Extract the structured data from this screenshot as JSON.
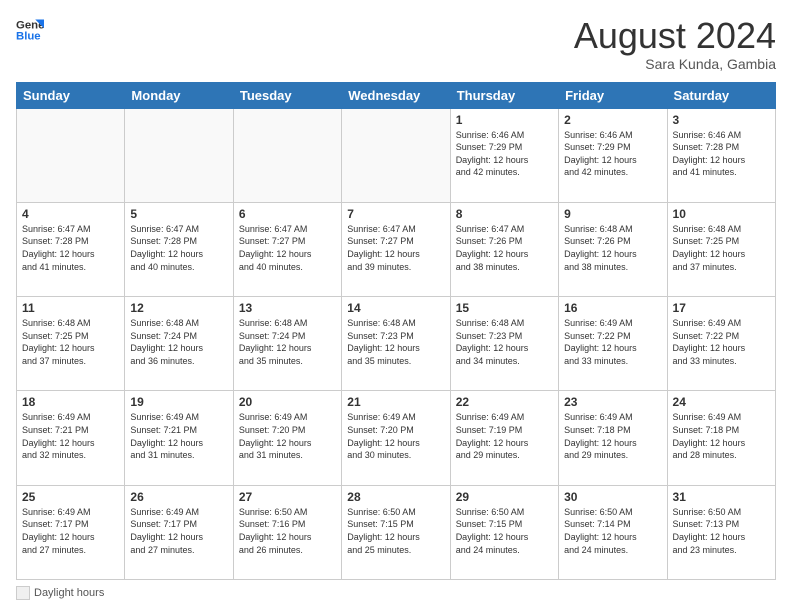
{
  "logo": {
    "line1": "General",
    "line2": "Blue",
    "tagline": ""
  },
  "header": {
    "month": "August 2024",
    "location": "Sara Kunda, Gambia"
  },
  "weekdays": [
    "Sunday",
    "Monday",
    "Tuesday",
    "Wednesday",
    "Thursday",
    "Friday",
    "Saturday"
  ],
  "weeks": [
    [
      {
        "day": "",
        "info": ""
      },
      {
        "day": "",
        "info": ""
      },
      {
        "day": "",
        "info": ""
      },
      {
        "day": "",
        "info": ""
      },
      {
        "day": "1",
        "info": "Sunrise: 6:46 AM\nSunset: 7:29 PM\nDaylight: 12 hours\nand 42 minutes."
      },
      {
        "day": "2",
        "info": "Sunrise: 6:46 AM\nSunset: 7:29 PM\nDaylight: 12 hours\nand 42 minutes."
      },
      {
        "day": "3",
        "info": "Sunrise: 6:46 AM\nSunset: 7:28 PM\nDaylight: 12 hours\nand 41 minutes."
      }
    ],
    [
      {
        "day": "4",
        "info": "Sunrise: 6:47 AM\nSunset: 7:28 PM\nDaylight: 12 hours\nand 41 minutes."
      },
      {
        "day": "5",
        "info": "Sunrise: 6:47 AM\nSunset: 7:28 PM\nDaylight: 12 hours\nand 40 minutes."
      },
      {
        "day": "6",
        "info": "Sunrise: 6:47 AM\nSunset: 7:27 PM\nDaylight: 12 hours\nand 40 minutes."
      },
      {
        "day": "7",
        "info": "Sunrise: 6:47 AM\nSunset: 7:27 PM\nDaylight: 12 hours\nand 39 minutes."
      },
      {
        "day": "8",
        "info": "Sunrise: 6:47 AM\nSunset: 7:26 PM\nDaylight: 12 hours\nand 38 minutes."
      },
      {
        "day": "9",
        "info": "Sunrise: 6:48 AM\nSunset: 7:26 PM\nDaylight: 12 hours\nand 38 minutes."
      },
      {
        "day": "10",
        "info": "Sunrise: 6:48 AM\nSunset: 7:25 PM\nDaylight: 12 hours\nand 37 minutes."
      }
    ],
    [
      {
        "day": "11",
        "info": "Sunrise: 6:48 AM\nSunset: 7:25 PM\nDaylight: 12 hours\nand 37 minutes."
      },
      {
        "day": "12",
        "info": "Sunrise: 6:48 AM\nSunset: 7:24 PM\nDaylight: 12 hours\nand 36 minutes."
      },
      {
        "day": "13",
        "info": "Sunrise: 6:48 AM\nSunset: 7:24 PM\nDaylight: 12 hours\nand 35 minutes."
      },
      {
        "day": "14",
        "info": "Sunrise: 6:48 AM\nSunset: 7:23 PM\nDaylight: 12 hours\nand 35 minutes."
      },
      {
        "day": "15",
        "info": "Sunrise: 6:48 AM\nSunset: 7:23 PM\nDaylight: 12 hours\nand 34 minutes."
      },
      {
        "day": "16",
        "info": "Sunrise: 6:49 AM\nSunset: 7:22 PM\nDaylight: 12 hours\nand 33 minutes."
      },
      {
        "day": "17",
        "info": "Sunrise: 6:49 AM\nSunset: 7:22 PM\nDaylight: 12 hours\nand 33 minutes."
      }
    ],
    [
      {
        "day": "18",
        "info": "Sunrise: 6:49 AM\nSunset: 7:21 PM\nDaylight: 12 hours\nand 32 minutes."
      },
      {
        "day": "19",
        "info": "Sunrise: 6:49 AM\nSunset: 7:21 PM\nDaylight: 12 hours\nand 31 minutes."
      },
      {
        "day": "20",
        "info": "Sunrise: 6:49 AM\nSunset: 7:20 PM\nDaylight: 12 hours\nand 31 minutes."
      },
      {
        "day": "21",
        "info": "Sunrise: 6:49 AM\nSunset: 7:20 PM\nDaylight: 12 hours\nand 30 minutes."
      },
      {
        "day": "22",
        "info": "Sunrise: 6:49 AM\nSunset: 7:19 PM\nDaylight: 12 hours\nand 29 minutes."
      },
      {
        "day": "23",
        "info": "Sunrise: 6:49 AM\nSunset: 7:18 PM\nDaylight: 12 hours\nand 29 minutes."
      },
      {
        "day": "24",
        "info": "Sunrise: 6:49 AM\nSunset: 7:18 PM\nDaylight: 12 hours\nand 28 minutes."
      }
    ],
    [
      {
        "day": "25",
        "info": "Sunrise: 6:49 AM\nSunset: 7:17 PM\nDaylight: 12 hours\nand 27 minutes."
      },
      {
        "day": "26",
        "info": "Sunrise: 6:49 AM\nSunset: 7:17 PM\nDaylight: 12 hours\nand 27 minutes."
      },
      {
        "day": "27",
        "info": "Sunrise: 6:50 AM\nSunset: 7:16 PM\nDaylight: 12 hours\nand 26 minutes."
      },
      {
        "day": "28",
        "info": "Sunrise: 6:50 AM\nSunset: 7:15 PM\nDaylight: 12 hours\nand 25 minutes."
      },
      {
        "day": "29",
        "info": "Sunrise: 6:50 AM\nSunset: 7:15 PM\nDaylight: 12 hours\nand 24 minutes."
      },
      {
        "day": "30",
        "info": "Sunrise: 6:50 AM\nSunset: 7:14 PM\nDaylight: 12 hours\nand 24 minutes."
      },
      {
        "day": "31",
        "info": "Sunrise: 6:50 AM\nSunset: 7:13 PM\nDaylight: 12 hours\nand 23 minutes."
      }
    ]
  ],
  "footer": {
    "daylight_label": "Daylight hours"
  }
}
